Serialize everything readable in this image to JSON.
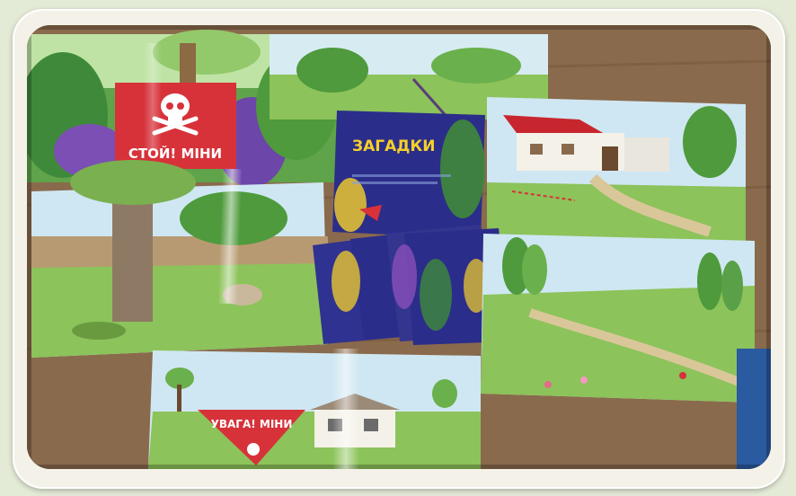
{
  "photo": {
    "sign_stop": "СТОЙ! МІНИ",
    "sign_warning": "УВАГА! МІНИ",
    "booklet_title": "ЗАГАДКИ",
    "booklet_subtitle": "",
    "colors": {
      "sign_red": "#d7323a",
      "booklet_blue": "#2b2d8a",
      "grass_green": "#8cc35a",
      "sky_blue": "#cfe7f2",
      "table_wood": "#8a6a4c",
      "frame": "#f4f2e8"
    }
  }
}
